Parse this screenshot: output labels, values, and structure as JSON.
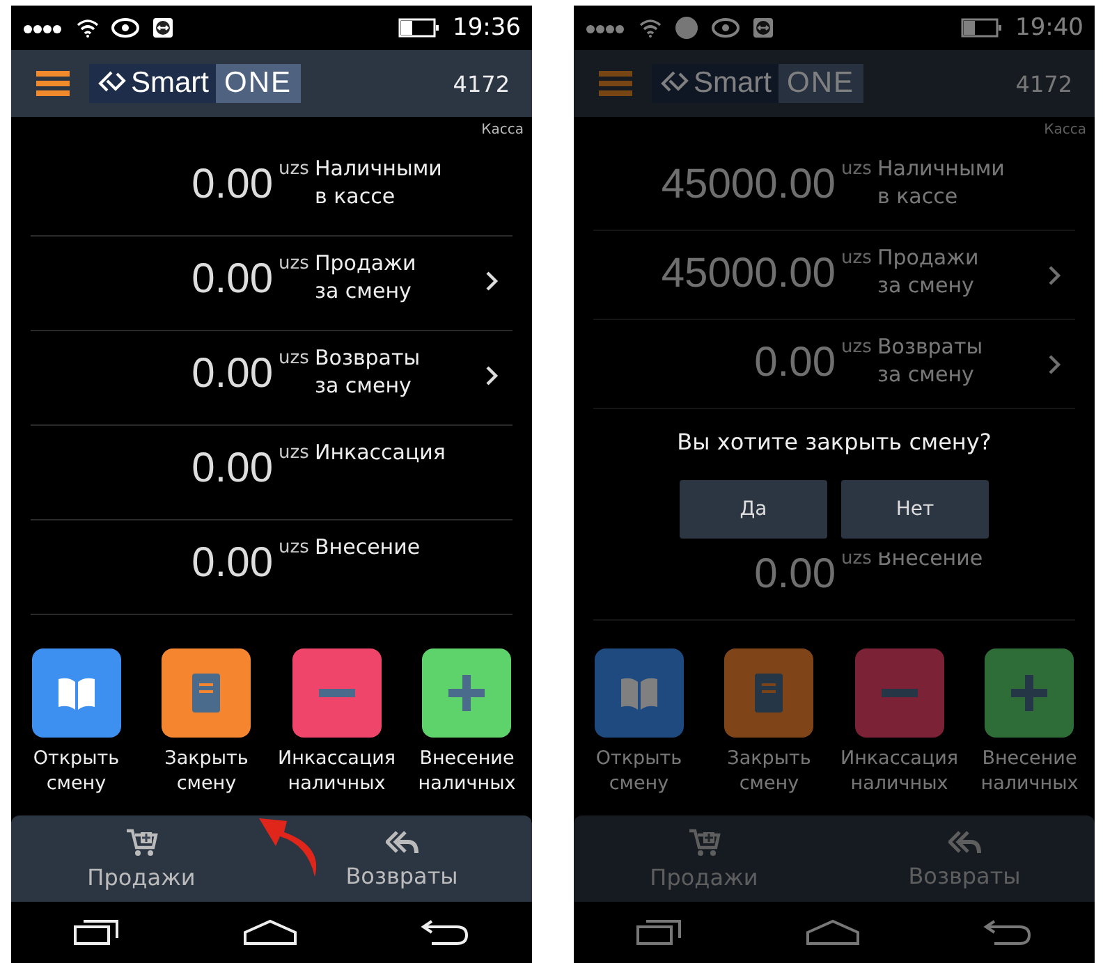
{
  "screens": [
    {
      "dimmed": false,
      "pointer_arrow": true,
      "status_bar": {
        "time": "19:36",
        "extra_dot": false
      },
      "header": {
        "logo_left": "Smart",
        "logo_right": "ONE",
        "number": "4172"
      },
      "caption": "Касса",
      "rows": [
        {
          "amount": "0.00",
          "currency": "uzs",
          "label": "Наличными\nв кассе",
          "chevron": false
        },
        {
          "amount": "0.00",
          "currency": "uzs",
          "label": "Продажи\nза смену",
          "chevron": true
        },
        {
          "amount": "0.00",
          "currency": "uzs",
          "label": "Возвраты\nза смену",
          "chevron": true
        },
        {
          "amount": "0.00",
          "currency": "uzs",
          "label": "Инкассация",
          "chevron": false
        },
        {
          "amount": "0.00",
          "currency": "uzs",
          "label": "Внесение",
          "chevron": false
        }
      ],
      "actions": [
        {
          "kind": "open-book",
          "color": "#3d8ff0",
          "label": "Открыть\nсмену"
        },
        {
          "kind": "closed-book",
          "color": "#f5862f",
          "label": "Закрыть\nсмену"
        },
        {
          "kind": "minus",
          "color": "#f0456a",
          "label": "Инкассация\nналичных"
        },
        {
          "kind": "plus",
          "color": "#5fd36b",
          "label": "Внесение\nналичных"
        }
      ],
      "tabs": [
        {
          "kind": "cart",
          "label": "Продажи"
        },
        {
          "kind": "reply",
          "label": "Возвраты"
        }
      ]
    },
    {
      "dimmed": true,
      "pointer_arrow": false,
      "status_bar": {
        "time": "19:40",
        "extra_dot": true
      },
      "header": {
        "logo_left": "Smart",
        "logo_right": "ONE",
        "number": "4172"
      },
      "caption": "Касса",
      "rows": [
        {
          "amount": "45000.00",
          "currency": "uzs",
          "label": "Наличными\nв кассе",
          "chevron": false
        },
        {
          "amount": "45000.00",
          "currency": "uzs",
          "label": "Продажи\nза смену",
          "chevron": true
        },
        {
          "amount": "0.00",
          "currency": "uzs",
          "label": "Возвраты\nза смену",
          "chevron": true
        }
      ],
      "dialog": {
        "question": "Вы хотите закрыть смену?",
        "buttons": [
          "Да",
          "Нет"
        ]
      },
      "rows_after": [
        {
          "amount": "0.00",
          "currency": "uzs",
          "label": "Внесение",
          "chevron": false
        }
      ],
      "actions": [
        {
          "kind": "open-book",
          "color": "#1f4a80",
          "label": "Открыть\nсмену"
        },
        {
          "kind": "closed-book",
          "color": "#7f4518",
          "label": "Закрыть\nсмену"
        },
        {
          "kind": "minus",
          "color": "#7c2236",
          "label": "Инкассация\nналичных"
        },
        {
          "kind": "plus",
          "color": "#2f6d38",
          "label": "Внесение\nналичных"
        }
      ],
      "tabs": [
        {
          "kind": "cart",
          "label": "Продажи"
        },
        {
          "kind": "reply",
          "label": "Возвраты"
        }
      ]
    }
  ]
}
